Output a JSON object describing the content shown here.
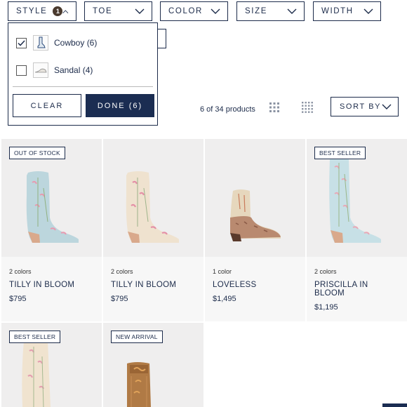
{
  "filters": {
    "style": {
      "label": "STYLE",
      "count": "1"
    },
    "toe": {
      "label": "TOE"
    },
    "color": {
      "label": "COLOR"
    },
    "size": {
      "label": "SIZE"
    },
    "width": {
      "label": "WIDTH"
    }
  },
  "dropdown": {
    "options": [
      {
        "label": "Cowboy (6)",
        "checked": true,
        "icon": "cowboy-boot-icon"
      },
      {
        "label": "Sandal (4)",
        "checked": false,
        "icon": "sandal-icon"
      }
    ],
    "clear_label": "CLEAR",
    "done_label": "DONE (6)"
  },
  "results": {
    "count_text": "6 of 34 products",
    "sort_label": "SORT BY"
  },
  "products": [
    {
      "badge": "OUT OF STOCK",
      "colors": "2 colors",
      "name": "TILLY IN BLOOM",
      "price": "$795"
    },
    {
      "badge": "",
      "colors": "2 colors",
      "name": "TILLY IN BLOOM",
      "price": "$795"
    },
    {
      "badge": "",
      "colors": "1 color",
      "name": "LOVELESS",
      "price": "$1,495"
    },
    {
      "badge": "BEST SELLER",
      "colors": "2 colors",
      "name": "PRISCILLA IN BLOOM",
      "price": "$1,195"
    },
    {
      "badge": "BEST SELLER"
    },
    {
      "badge": "NEW ARRIVAL"
    }
  ],
  "theme": {
    "navy": "#1b2d52",
    "text": "#1c2b4a",
    "card_bg": "#efeeee",
    "badge_count": "#4a3a2e"
  }
}
